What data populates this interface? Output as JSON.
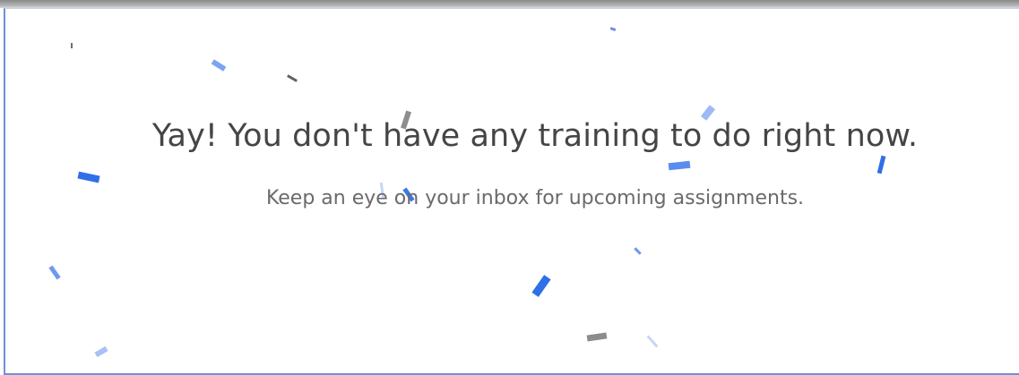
{
  "empty_state": {
    "headline": "Yay! You don't have any training to do right now.",
    "subtext": "Keep an eye on your inbox for upcoming assignments."
  },
  "colors": {
    "confetti_blue": "#2f6fe8",
    "confetti_light_blue": "#8fb2f5",
    "confetti_gray": "#8c8c8c",
    "headline": "#454545",
    "subtext": "#6a6a6a"
  }
}
